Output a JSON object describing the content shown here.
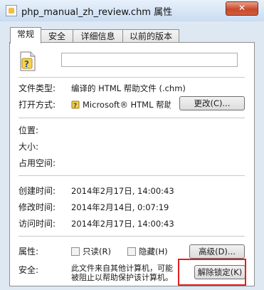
{
  "window": {
    "title": "php_manual_zh_review.chm 属性",
    "close_label": "✕"
  },
  "tabs": [
    {
      "label": "常规",
      "active": true
    },
    {
      "label": "安全",
      "active": false
    },
    {
      "label": "详细信息",
      "active": false
    },
    {
      "label": "以前的版本",
      "active": false
    }
  ],
  "general": {
    "filename_value": "",
    "file_type_label": "文件类型:",
    "file_type_value": "编译的 HTML 帮助文件 (.chm)",
    "open_with_label": "打开方式:",
    "open_with_value": "Microsoft® HTML 帮助",
    "change_button": "更改(C)...",
    "location_label": "位置:",
    "size_label": "大小:",
    "size_on_disk_label": "占用空间:",
    "created_label": "创建时间:",
    "created_value": "2014年2月17日, 14:00:43",
    "modified_label": "修改时间:",
    "modified_value": "2014年2月14日, 0:07:19",
    "accessed_label": "访问时间:",
    "accessed_value": "2014年2月17日, 14:00:43",
    "attributes_label": "属性:",
    "readonly_label": "只读(R)",
    "hidden_label": "隐藏(H)",
    "advanced_button": "高级(D)...",
    "security_label": "安全:",
    "security_text_1": "此文件来自其他计算机，可能",
    "security_text_2": "被阻止以帮助保护该计算机。",
    "unblock_button": "解除锁定(K)"
  },
  "icons": {
    "file": "chm-file-icon",
    "program": "help-program-icon",
    "window": "window-icon"
  },
  "colors": {
    "highlight": "#e02020",
    "titlebar": "#c9dcf1",
    "close": "#c74a2c"
  }
}
